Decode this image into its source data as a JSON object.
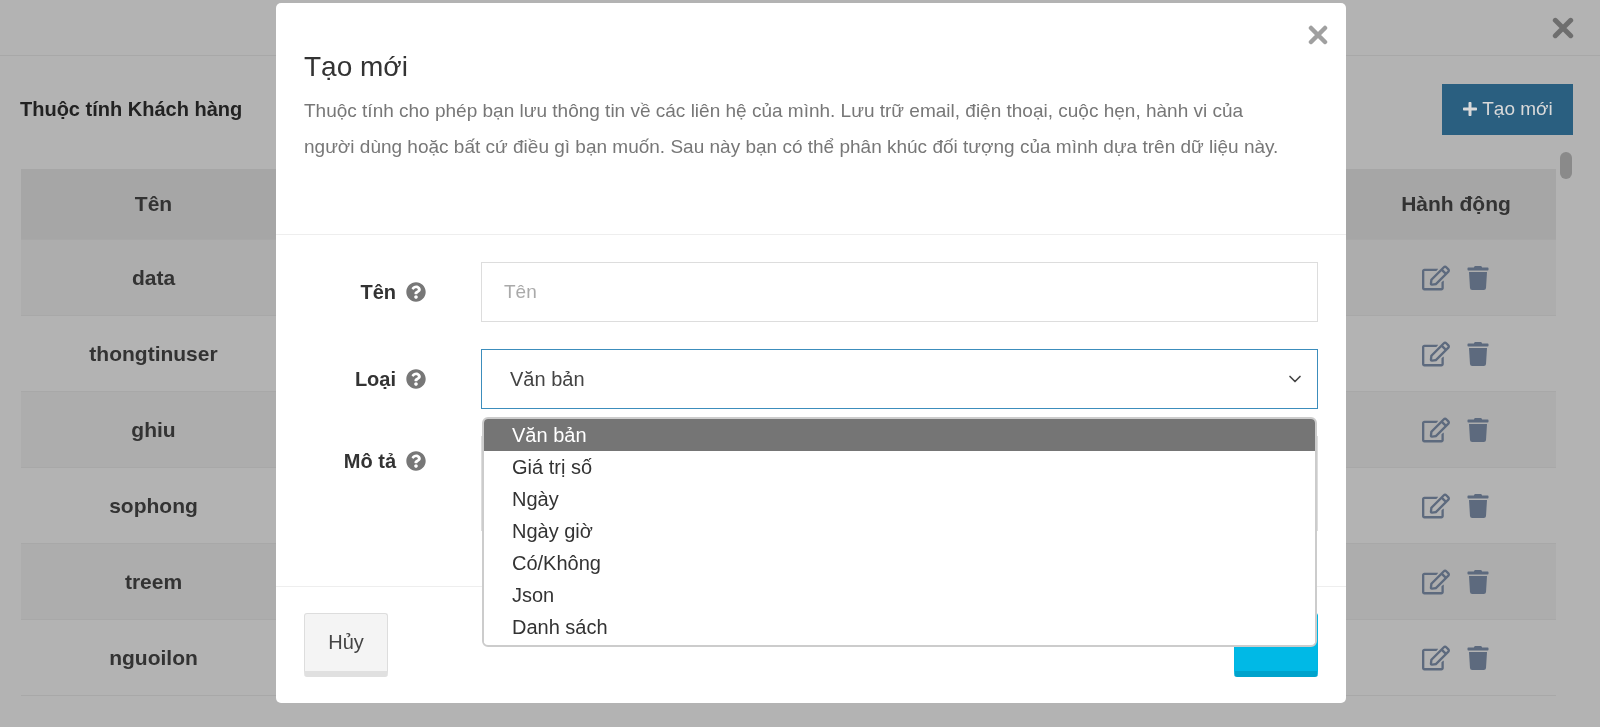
{
  "page": {
    "title": "Thuộc tính Khách hàng",
    "create_button": "Tạo mới"
  },
  "table": {
    "columns": [
      "Tên",
      "Hành động"
    ],
    "rows": [
      {
        "name": "data"
      },
      {
        "name": "thongtinuser"
      },
      {
        "name": "ghiu"
      },
      {
        "name": "sophong"
      },
      {
        "name": "treem"
      },
      {
        "name": "nguoilon"
      }
    ]
  },
  "modal": {
    "title": "Tạo mới",
    "description": "Thuộc tính cho phép bạn lưu thông tin về các liên hệ của mình. Lưu trữ email, điện thoại, cuộc hẹn, hành vi của người dùng hoặc bất cứ điều gì bạn muốn. Sau này bạn có thể phân khúc đối tượng của mình dựa trên dữ liệu này.",
    "fields": [
      {
        "label": "Tên",
        "kind": "input",
        "placeholder": "Tên"
      },
      {
        "label": "Loại",
        "kind": "select",
        "value": "Văn bản",
        "expanded": true,
        "options": [
          {
            "label": "Văn bản",
            "selected": true
          },
          {
            "label": "Giá trị số",
            "selected": false
          },
          {
            "label": "Ngày",
            "selected": false
          },
          {
            "label": "Ngày giờ",
            "selected": false
          },
          {
            "label": "Có/Không",
            "selected": false
          },
          {
            "label": "Json",
            "selected": false
          },
          {
            "label": "Danh sách",
            "selected": false
          }
        ]
      },
      {
        "label": "Mô tả",
        "kind": "textarea"
      }
    ],
    "buttons": [
      {
        "label": "Hủy",
        "kind": "secondary"
      },
      {
        "kind": "primary"
      }
    ]
  }
}
